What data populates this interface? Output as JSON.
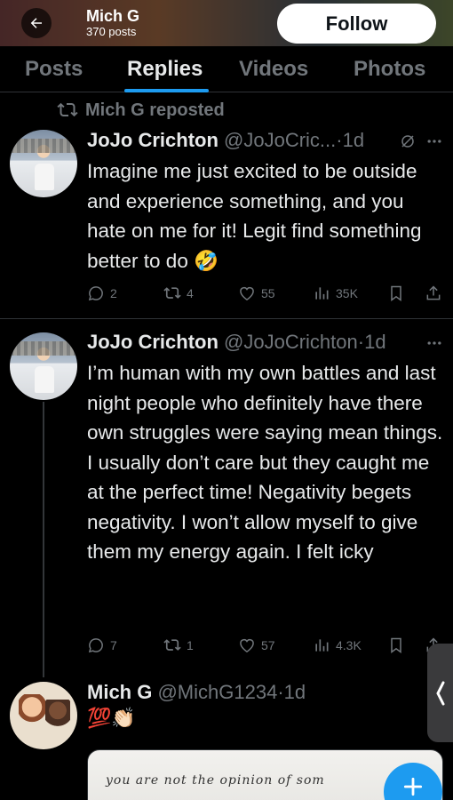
{
  "header": {
    "name": "Mich G",
    "posts_count": "370 posts",
    "follow_label": "Follow"
  },
  "tabs": [
    {
      "label": "Posts",
      "active": false
    },
    {
      "label": "Replies",
      "active": true
    },
    {
      "label": "Videos",
      "active": false
    },
    {
      "label": "Photos",
      "active": false
    }
  ],
  "repost_label": "Mich G reposted",
  "tweets": [
    {
      "name": "JoJo Crichton",
      "handle": "@JoJoCric...",
      "time": "·1d",
      "text": "Imagine me just excited to be outside and experience something, and you hate on me for it! Legit find something better to do 🤣",
      "actions": {
        "replies": "2",
        "reposts": "4",
        "likes": "55",
        "views": "35K"
      }
    },
    {
      "name": "JoJo Crichton",
      "handle": "@JoJoCrichton",
      "time": "·1d",
      "text": "I’m human with my own battles and last night people who definitely have there own struggles were saying mean things. I usually don’t care but they caught me at the perfect time! Negativity begets negativity. I won’t allow myself to give them my energy again. I felt icky",
      "actions": {
        "replies": "7",
        "reposts": "1",
        "likes": "57",
        "views": "4.3K"
      }
    },
    {
      "name": "Mich G",
      "handle": "@MichG1234",
      "time": "·1d",
      "text": "💯👏🏻",
      "image_text": "you are not the opinion of som"
    }
  ],
  "colors": {
    "accent": "#1d9bf0",
    "muted": "#71767b",
    "text": "#e7e9ea",
    "background": "#000000"
  }
}
